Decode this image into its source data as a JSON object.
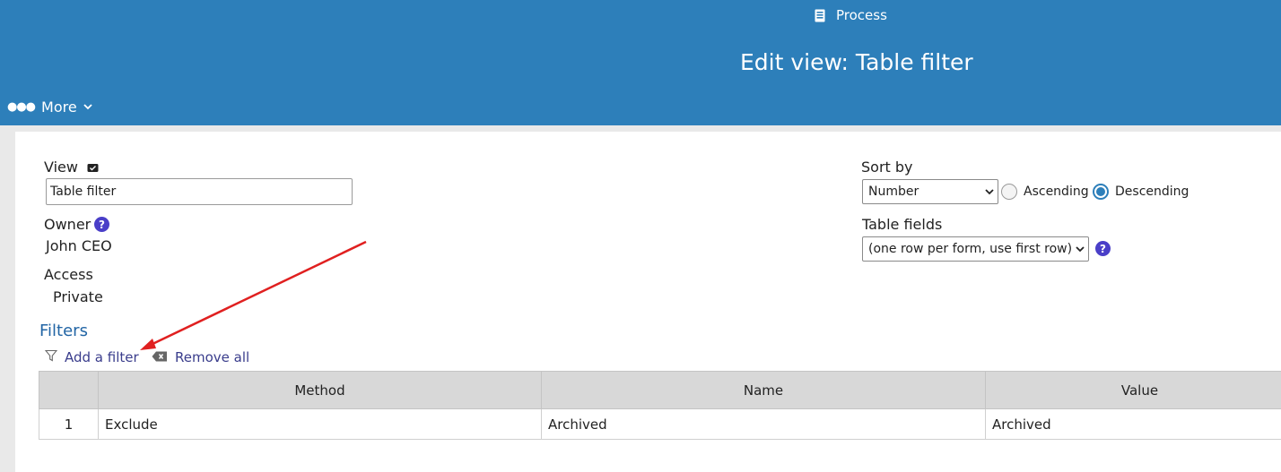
{
  "header": {
    "process_label": "Process",
    "title": "Edit view: Table filter",
    "more_label": "More",
    "bg_color": "#2d7fba"
  },
  "view": {
    "label": "View",
    "name_value": "Table filter",
    "owner_label": "Owner",
    "owner_value": "John CEO",
    "access_label": "Access",
    "access_value": "Private"
  },
  "sort": {
    "label": "Sort by",
    "selected": "Number",
    "ascending_label": "Ascending",
    "descending_label": "Descending",
    "order": "descending"
  },
  "table_fields": {
    "label": "Table fields",
    "selected": "(one row per form, use first row)"
  },
  "filters": {
    "heading": "Filters",
    "add_label": "Add a filter",
    "remove_label": "Remove all",
    "columns": [
      "Method",
      "Name",
      "Value"
    ],
    "rows": [
      {
        "index": "1",
        "method": "Exclude",
        "name": "Archived",
        "value": "Archived"
      }
    ]
  },
  "icons": [
    "document-icon",
    "chevron-down-icon",
    "edit-icon",
    "help-icon",
    "filter-icon",
    "clear-icon"
  ],
  "colors": {
    "accent": "#2d7fba",
    "link": "#3a3d8c",
    "help": "#4a3fc8",
    "annotation_arrow": "#e02020"
  }
}
